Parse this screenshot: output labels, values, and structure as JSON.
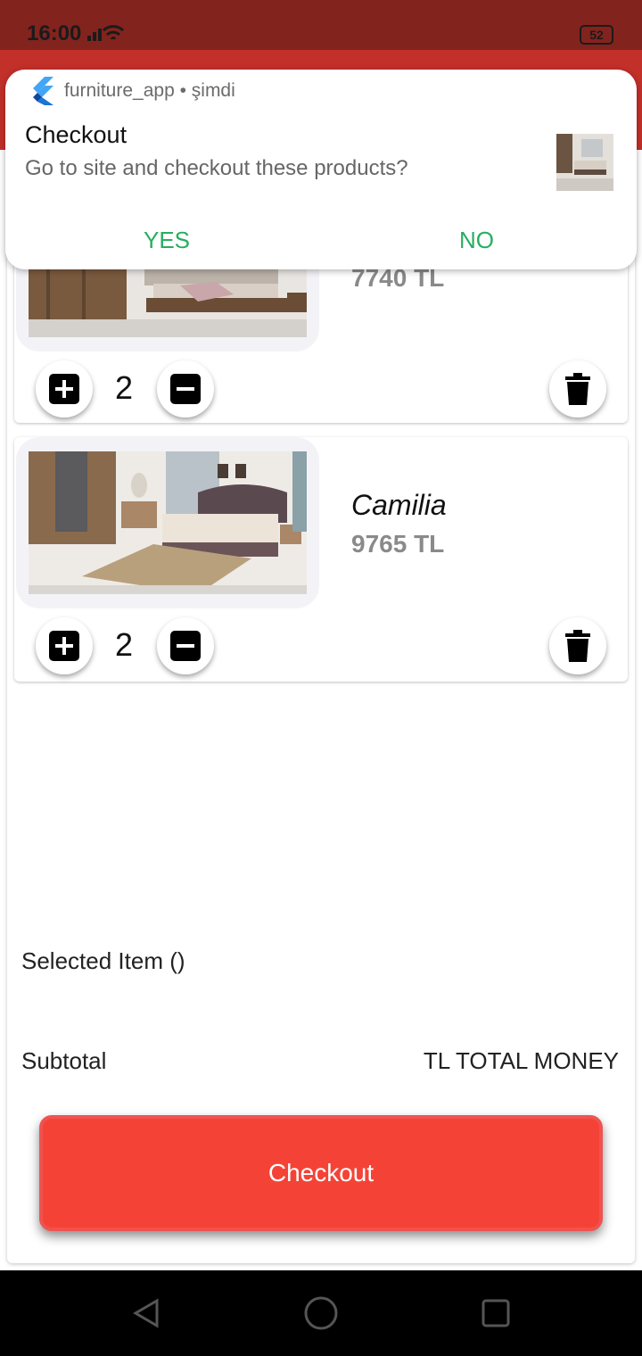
{
  "status_bar": {
    "time": "16:00",
    "battery": "52"
  },
  "notification": {
    "app_name": "furniture_app • şimdi",
    "title": "Checkout",
    "body": "Go to site and checkout these products?",
    "yes_label": "YES",
    "no_label": "NO"
  },
  "cart": {
    "items": [
      {
        "price": "7740 TL",
        "quantity": "2"
      },
      {
        "name": "Camilia",
        "price": "9765 TL",
        "quantity": "2"
      }
    ]
  },
  "summary": {
    "selected_label": "Selected Item ()",
    "subtotal_label": "Subtotal",
    "total_value": "TL TOTAL MONEY"
  },
  "checkout_label": "Checkout",
  "colors": {
    "status_bar": "#83231d",
    "app_bar": "#c3302a",
    "checkout_button": "#f44336",
    "notification_action": "#27ae60",
    "price": "#8a8a8a"
  }
}
